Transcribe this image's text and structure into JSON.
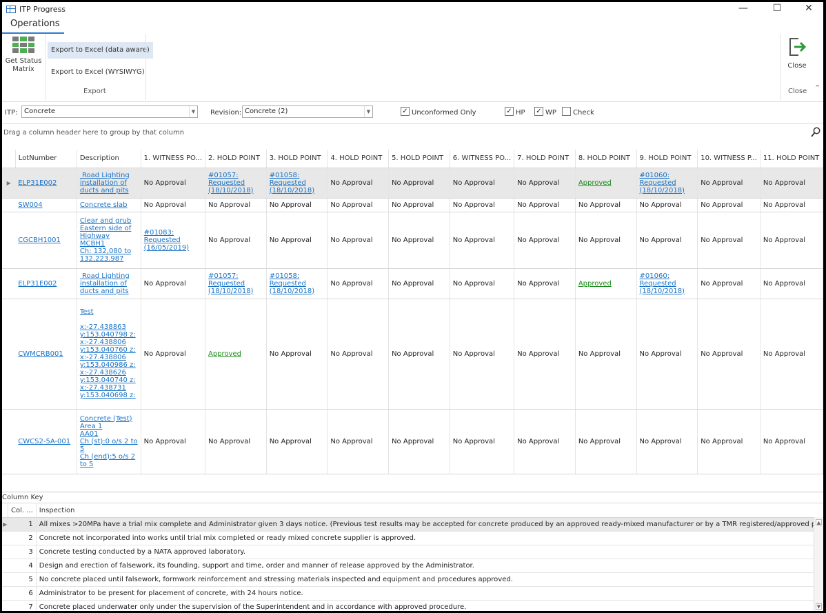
{
  "window": {
    "title": "ITP Progress",
    "min_glyph": "—",
    "max_glyph": "☐",
    "close_glyph": "✕"
  },
  "ribbon": {
    "tab_label": "Operations",
    "get_status_line1": "Get Status",
    "get_status_line2": "Matrix",
    "export_aware": "Export to Excel (data aware)",
    "export_wysiwyg": "Export to Excel (WYSIWYG)",
    "export_group": "Export",
    "close_button": "Close",
    "close_group": "Close",
    "accent_color": "#2b7bcb",
    "close_icon": "exit-arrow-icon"
  },
  "filters": {
    "itp_label": "ITP:",
    "itp_value": "Concrete",
    "revision_label": "Revision:",
    "revision_value": "Concrete (2)",
    "unconformed_label": "Unconformed Only",
    "unconformed_checked": true,
    "hp_label": "HP",
    "hp_checked": true,
    "wp_label": "WP",
    "wp_checked": true,
    "check_label": "Check",
    "check_checked": false
  },
  "group_panel": {
    "hint": "Drag a column header here to group by that column"
  },
  "grid": {
    "columns": [
      "LotNumber",
      "Description",
      "1. WITNESS PO...",
      "2. HOLD POINT",
      "3. HOLD POINT",
      "4. HOLD POINT",
      "5. HOLD POINT",
      "6. WITNESS PO...",
      "7. HOLD POINT",
      "8. HOLD POINT",
      "9. HOLD POINT",
      "10. WITNESS P...",
      "11. HOLD POINT"
    ],
    "rows": [
      {
        "lot": "ELP31E002",
        "desc": [
          " Road Lighting",
          "installation of",
          "ducts and pits"
        ],
        "cells": [
          [
            "No Approval"
          ],
          [
            "#01057:",
            "Requested",
            "(18/10/2018)"
          ],
          [
            "#01058:",
            "Requested",
            "(18/10/2018)"
          ],
          [
            "No Approval"
          ],
          [
            "No Approval"
          ],
          [
            "No Approval"
          ],
          [
            "No Approval"
          ],
          [
            "Approved"
          ],
          [
            "#01060:",
            "Requested",
            "(18/10/2018)"
          ],
          [
            "No Approval"
          ],
          [
            "No Approval"
          ]
        ]
      },
      {
        "lot": "SW004",
        "desc": [
          "Concrete slab"
        ],
        "cells": [
          [
            "No Approval"
          ],
          [
            "No Approval"
          ],
          [
            "No Approval"
          ],
          [
            "No Approval"
          ],
          [
            "No Approval"
          ],
          [
            "No Approval"
          ],
          [
            "No Approval"
          ],
          [
            "No Approval"
          ],
          [
            "No Approval"
          ],
          [
            "No Approval"
          ],
          [
            "No Approval"
          ]
        ]
      },
      {
        "lot": "CGCBH1001",
        "desc": [
          "Clear and grub",
          "Eastern side of",
          "Highway",
          "MCBH1",
          "Ch: 132,080 to",
          "132,223.987"
        ],
        "cells": [
          [
            "#01083:",
            "Requested",
            "(16/05/2019)"
          ],
          [
            "No Approval"
          ],
          [
            "No Approval"
          ],
          [
            "No Approval"
          ],
          [
            "No Approval"
          ],
          [
            "No Approval"
          ],
          [
            "No Approval"
          ],
          [
            "No Approval"
          ],
          [
            "No Approval"
          ],
          [
            "No Approval"
          ],
          [
            "No Approval"
          ]
        ]
      },
      {
        "lot": "ELP31E002",
        "desc": [
          " Road Lighting",
          "installation of",
          "ducts and pits"
        ],
        "cells": [
          [
            "No Approval"
          ],
          [
            "#01057:",
            "Requested",
            "(18/10/2018)"
          ],
          [
            "#01058:",
            "Requested",
            "(18/10/2018)"
          ],
          [
            "No Approval"
          ],
          [
            "No Approval"
          ],
          [
            "No Approval"
          ],
          [
            "No Approval"
          ],
          [
            "Approved"
          ],
          [
            "#01060:",
            "Requested",
            "(18/10/2018)"
          ],
          [
            "No Approval"
          ],
          [
            "No Approval"
          ]
        ]
      },
      {
        "lot": "CWMCRB001",
        "desc": [
          "Test",
          "",
          "x:-27.438863",
          "y:153.040798 z:",
          "x:-27.438806",
          "y:153.040760 z:",
          "x:-27.438806",
          "y:153.040986 z:",
          "x:-27.438626",
          "y:153.040740 z:",
          "x:-27.438731",
          "y:153.040698 z:"
        ],
        "cells": [
          [
            "No Approval"
          ],
          [
            "Approved"
          ],
          [
            "No Approval"
          ],
          [
            "No Approval"
          ],
          [
            "No Approval"
          ],
          [
            "No Approval"
          ],
          [
            "No Approval"
          ],
          [
            "No Approval"
          ],
          [
            "No Approval"
          ],
          [
            "No Approval"
          ],
          [
            "No Approval"
          ]
        ]
      },
      {
        "lot": "CWCS2-5A-001",
        "desc": [
          "Concrete (Test)",
          "Area 1",
          "AA01",
          "Ch (st):0 o/s 2 to",
          "5",
          "Ch (end):5 o/s 2",
          "to 5"
        ],
        "cells": [
          [
            "No Approval"
          ],
          [
            "No Approval"
          ],
          [
            "No Approval"
          ],
          [
            "No Approval"
          ],
          [
            "No Approval"
          ],
          [
            "No Approval"
          ],
          [
            "No Approval"
          ],
          [
            "No Approval"
          ],
          [
            "No Approval"
          ],
          [
            "No Approval"
          ],
          [
            "No Approval"
          ]
        ]
      }
    ]
  },
  "column_key": {
    "title": "Column Key",
    "columns": [
      "Col. ...",
      "Inspection"
    ],
    "rows": [
      {
        "num": "1",
        "text": "All mixes >20MPa have a trial mix complete and Administrator given 3 days notice.  (Previous test results may be accepted for concrete produced by an approved ready-mixed manufacturer or by a TMR registered/approved precast manufac..."
      },
      {
        "num": "2",
        "text": "Concrete not incorporated into works until trial mix completed or ready mixed concrete supplier is approved."
      },
      {
        "num": "3",
        "text": "Concrete testing conducted by a NATA approved laboratory."
      },
      {
        "num": "4",
        "text": "Design and erection of falsework, its founding, support and time, order and manner of release approved by the Administrator."
      },
      {
        "num": "5",
        "text": "No concrete placed until falsework, formwork reinforcement and stressing materials inspected and equipment and procedures approved."
      },
      {
        "num": "6",
        "text": "Administrator to be present for placement of concrete, with 24 hours notice."
      },
      {
        "num": "7",
        "text": "Concrete placed underwater only under the supervision of the Superintendent and in accordance with approved procedure."
      }
    ]
  }
}
